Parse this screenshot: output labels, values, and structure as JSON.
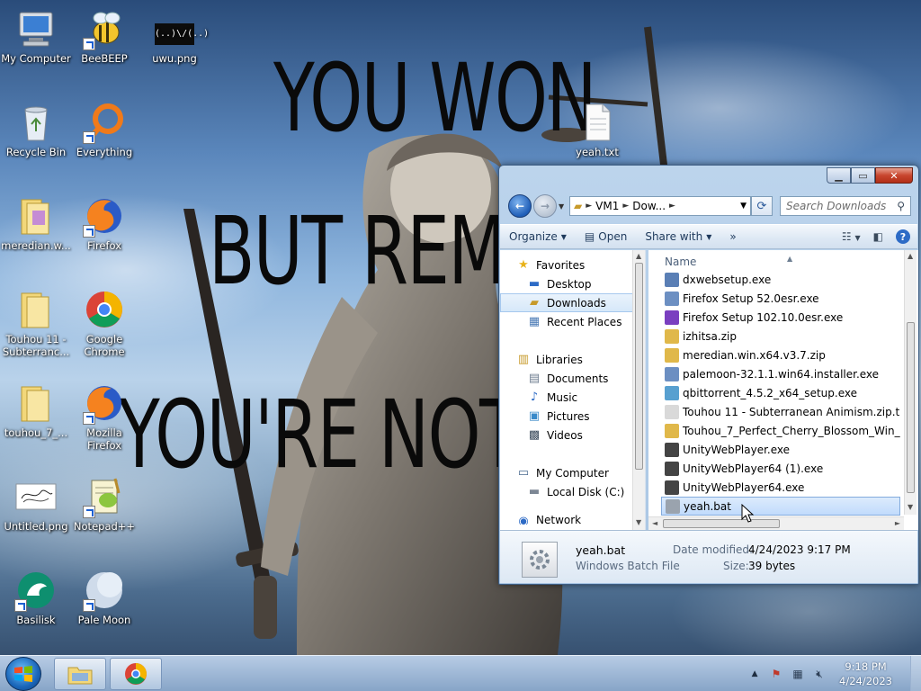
{
  "wallpaper": {
    "line1": "YOU WON",
    "line2": "BUT REME",
    "line3": "YOU'RE NOT"
  },
  "desktop_icons": [
    {
      "label": "My Computer",
      "icon": "computer-icon"
    },
    {
      "label": "BeeBEEP",
      "icon": "bee-icon"
    },
    {
      "label": "uwu.png",
      "icon": "image-file-icon",
      "thumb_text": "(..)\\/(..)"
    },
    {
      "label": "Recycle Bin",
      "icon": "recycle-bin-icon"
    },
    {
      "label": "Everything",
      "icon": "everything-search-icon"
    },
    {
      "label": "yeah.txt",
      "icon": "text-file-icon"
    },
    {
      "label": "meredian.w...",
      "icon": "folder-icon"
    },
    {
      "label": "Firefox",
      "icon": "firefox-icon"
    },
    {
      "label": "Touhou 11 - Subterranc...",
      "icon": "folder-icon"
    },
    {
      "label": "Google Chrome",
      "icon": "chrome-icon"
    },
    {
      "label": "touhou_7_...",
      "icon": "folder-icon"
    },
    {
      "label": "Mozilla Firefox",
      "icon": "firefox-icon"
    },
    {
      "label": "Untitled.png",
      "icon": "image-file-icon"
    },
    {
      "label": "Notepad++",
      "icon": "notepadpp-icon"
    },
    {
      "label": "Basilisk",
      "icon": "basilisk-icon"
    },
    {
      "label": "Pale Moon",
      "icon": "pale-moon-icon"
    }
  ],
  "explorer": {
    "address": {
      "root": "VM1",
      "current": "Dow..."
    },
    "search_placeholder": "Search Downloads",
    "toolbar": {
      "organize": "Organize",
      "open": "Open",
      "share_with": "Share with",
      "more": "»"
    },
    "nav": {
      "favorites": "Favorites",
      "desktop": "Desktop",
      "downloads": "Downloads",
      "recent_places": "Recent Places",
      "libraries": "Libraries",
      "documents": "Documents",
      "music": "Music",
      "pictures": "Pictures",
      "videos": "Videos",
      "my_computer": "My Computer",
      "local_disk": "Local Disk (C:)",
      "network": "Network"
    },
    "column_name": "Name",
    "files": [
      {
        "name": "dxwebsetup.exe",
        "color": "#5a7fb5"
      },
      {
        "name": "Firefox Setup 52.0esr.exe",
        "color": "#6c8fc2"
      },
      {
        "name": "Firefox Setup 102.10.0esr.exe",
        "color": "#7a3fc0"
      },
      {
        "name": "izhitsa.zip",
        "color": "#e0b84a"
      },
      {
        "name": "meredian.win.x64.v3.7.zip",
        "color": "#e0b84a"
      },
      {
        "name": "palemoon-32.1.1.win64.installer.exe",
        "color": "#6c8fc2"
      },
      {
        "name": "qbittorrent_4.5.2_x64_setup.exe",
        "color": "#58a0d0"
      },
      {
        "name": "Touhou 11 - Subterranean Animism.zip.t...",
        "color": "#d9d9d9"
      },
      {
        "name": "Touhou_7_Perfect_Cherry_Blossom_Win_...",
        "color": "#e0b84a"
      },
      {
        "name": "UnityWebPlayer.exe",
        "color": "#444444"
      },
      {
        "name": "UnityWebPlayer64 (1).exe",
        "color": "#444444"
      },
      {
        "name": "UnityWebPlayer64.exe",
        "color": "#444444"
      },
      {
        "name": "yeah.bat",
        "color": "#9aa3ae",
        "selected": true
      }
    ],
    "details": {
      "name": "yeah.bat",
      "type": "Windows Batch File",
      "date_label": "Date modified:",
      "date_value": "4/24/2023 9:17 PM",
      "size_label": "Size:",
      "size_value": "39 bytes"
    }
  },
  "taskbar": {
    "time": "9:18 PM",
    "date": "4/24/2023"
  }
}
